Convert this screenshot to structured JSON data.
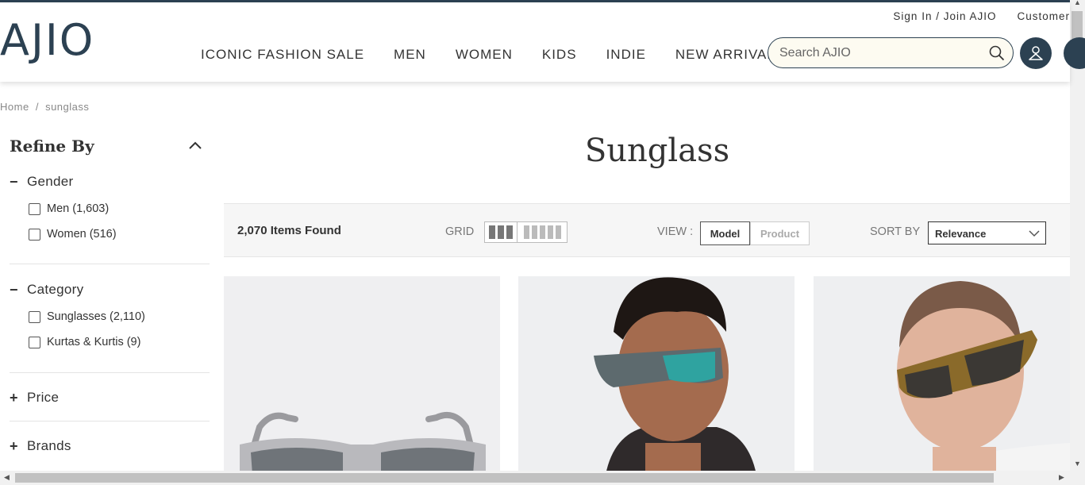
{
  "header": {
    "logo": "AJIO",
    "top_links": [
      "Sign In / Join AJIO",
      "Customer"
    ],
    "nav": [
      "ICONIC FASHION SALE",
      "MEN",
      "WOMEN",
      "KIDS",
      "INDIE",
      "NEW ARRIVALS"
    ],
    "search_placeholder": "Search AJIO"
  },
  "breadcrumb": [
    "Home",
    "/",
    "sunglass"
  ],
  "sidebar": {
    "title": "Refine By",
    "facets": [
      {
        "label": "Gender",
        "sign": "−",
        "options": [
          "Men (1,603)",
          "Women (516)"
        ]
      },
      {
        "label": "Category",
        "sign": "−",
        "options": [
          "Sunglasses (2,110)",
          "Kurtas & Kurtis (9)"
        ]
      },
      {
        "label": "Price",
        "sign": "+"
      },
      {
        "label": "Brands",
        "sign": "+"
      }
    ]
  },
  "main": {
    "title": "Sunglass",
    "items_found": "2,070 Items Found",
    "grid_label": "GRID",
    "view_label": "VIEW :",
    "view_options": [
      "Model",
      "Product"
    ],
    "sort_label": "SORT BY",
    "sort_value": "Relevance"
  },
  "colors": {
    "brand": "#2c4152",
    "search_bg": "#fdfbf1",
    "toolbar_bg": "#f6f6f6"
  }
}
